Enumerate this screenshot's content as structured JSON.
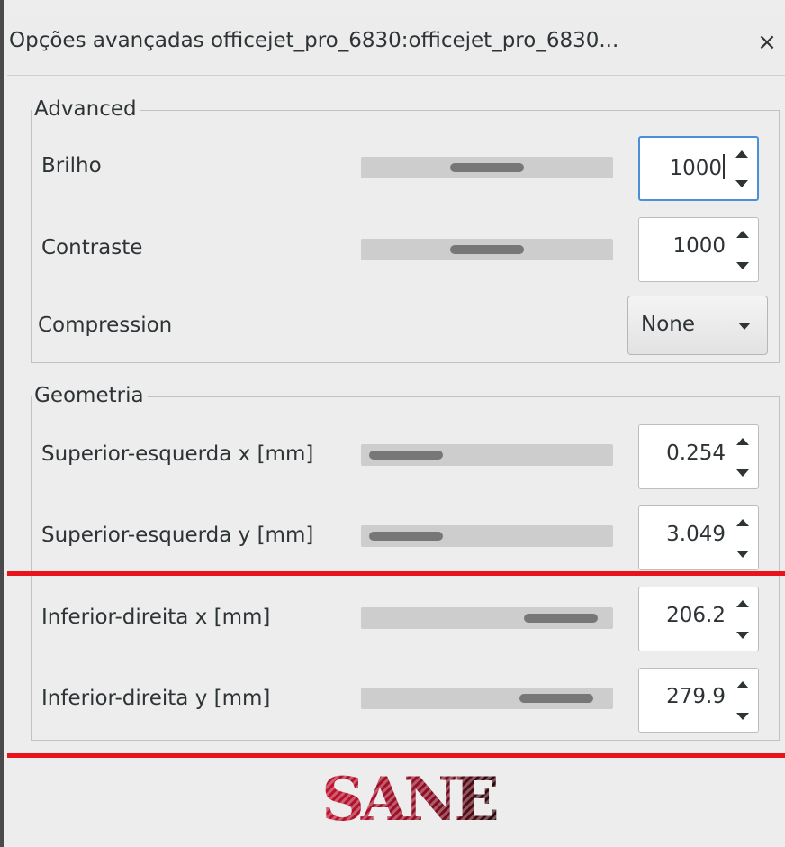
{
  "window": {
    "title": "Opções avançadas officejet_pro_6830:officejet_pro_6830...",
    "close_glyph": "×"
  },
  "advanced": {
    "label": "Advanced",
    "brightness": {
      "label": "Brilho",
      "value": "1000",
      "slider_position": 0.5
    },
    "contrast": {
      "label": "Contraste",
      "value": "1000",
      "slider_position": 0.5
    },
    "compression": {
      "label": "Compression",
      "value": "None"
    }
  },
  "geometry": {
    "label": "Geometria",
    "top_left_x": {
      "label": "Superior-esquerda x [mm]",
      "value": "0.254",
      "slider_position": 0.0
    },
    "top_left_y": {
      "label": "Superior-esquerda y [mm]",
      "value": "3.049",
      "slider_position": 0.0
    },
    "bottom_right_x": {
      "label": "Inferior-direita x [mm]",
      "value": "206.2",
      "slider_position": 0.95
    },
    "bottom_right_y": {
      "label": "Inferior-direita y [mm]",
      "value": "279.9",
      "slider_position": 0.93
    }
  },
  "logo": {
    "text": "SANE"
  },
  "colors": {
    "focus": "#4a90d9",
    "highlight_line": "#e8141c",
    "logo": "#b0102a"
  }
}
